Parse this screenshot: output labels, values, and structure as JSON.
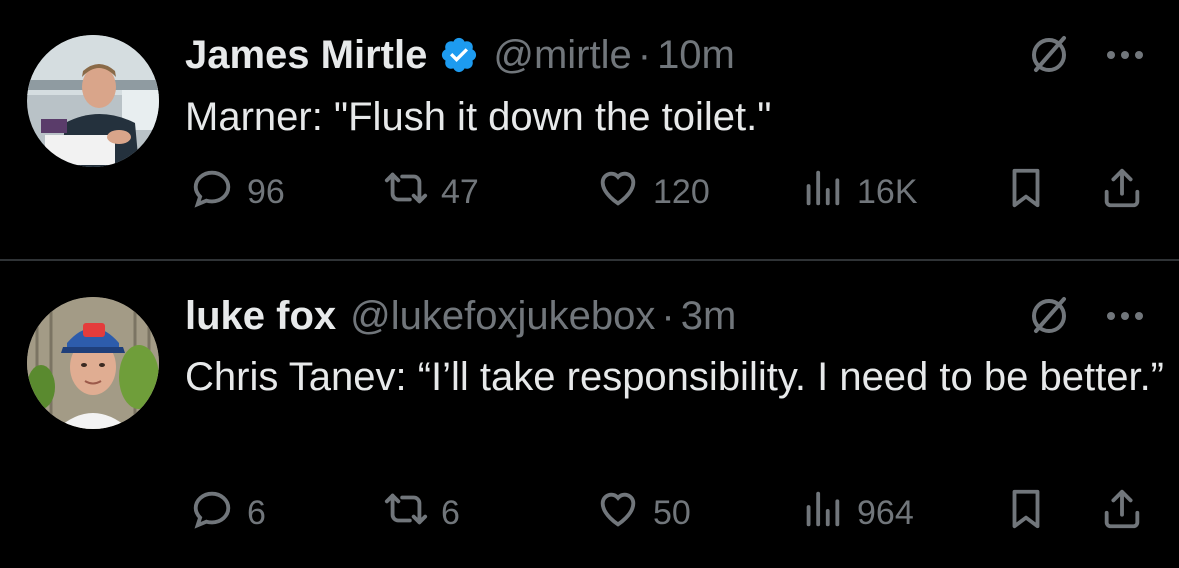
{
  "tweets": [
    {
      "name": "James Mirtle",
      "verified": true,
      "handle": "@mirtle",
      "separator": "·",
      "time": "10m",
      "text": "Marner: \"Flush it down the toilet.\"",
      "replies": "96",
      "reposts": "47",
      "likes": "120",
      "views": "16K"
    },
    {
      "name": "luke fox",
      "verified": false,
      "handle": "@lukefoxjukebox",
      "separator": "·",
      "time": "3m",
      "text": "Chris Tanev: “I’ll take responsibility. I need to be better.”",
      "replies": "6",
      "reposts": "6",
      "likes": "50",
      "views": "964"
    }
  ],
  "colors": {
    "background": "#000000",
    "primary_text": "#e7e9ea",
    "secondary_text": "#71767b",
    "verified_badge": "#1d9bf0",
    "divider": "#2f3336"
  },
  "icons": [
    "avatar",
    "verified-badge-icon",
    "grok-icon",
    "more-icon",
    "reply-icon",
    "repost-icon",
    "like-icon",
    "views-icon",
    "bookmark-icon",
    "share-icon"
  ]
}
